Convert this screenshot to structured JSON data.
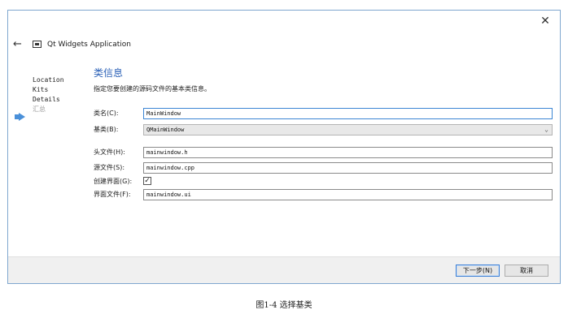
{
  "window": {
    "close_glyph": "✕",
    "back_glyph": "←",
    "app_title": "Qt Widgets Application"
  },
  "steps": [
    {
      "label": "Location",
      "current": false
    },
    {
      "label": "Kits",
      "current": false
    },
    {
      "label": "Details",
      "current": true
    },
    {
      "label": "汇总",
      "current": false
    }
  ],
  "page": {
    "title": "类信息",
    "description": "指定您要创建的源码文件的基本类信息。"
  },
  "form": {
    "class_name": {
      "label": "类名(C):",
      "value": "MainWindow"
    },
    "base_class": {
      "label": "基类(B):",
      "value": "QMainWindow",
      "chevron": "⌄"
    },
    "header_file": {
      "label": "头文件(H):",
      "value": "mainwindow.h"
    },
    "source_file": {
      "label": "源文件(S):",
      "value": "mainwindow.cpp"
    },
    "generate_form": {
      "label": "创建界面(G):",
      "checked": true,
      "check_glyph": "✓"
    },
    "form_file": {
      "label": "界面文件(F):",
      "value": "mainwindow.ui"
    }
  },
  "footer": {
    "next_label": "下一步(N)",
    "cancel_label": "取消"
  },
  "caption": "图1-4   选择基类",
  "colors": {
    "accent": "#4a90d9",
    "title": "#2e63b8",
    "focus_border": "#3c86d4"
  }
}
